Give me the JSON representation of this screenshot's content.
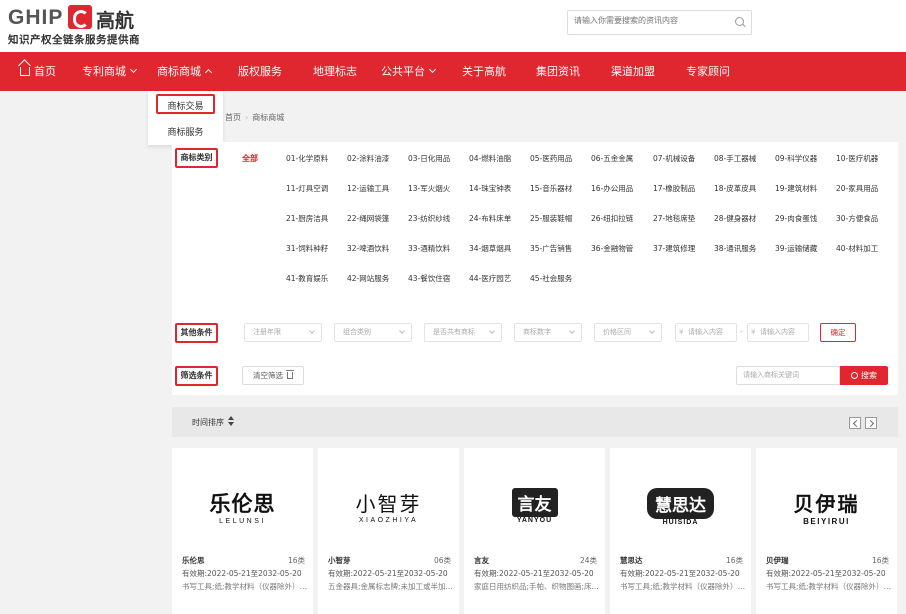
{
  "header": {
    "logo_text": "GHIP",
    "logo_cn": "高航",
    "slogan": "知识产权全链条服务提供商",
    "search_placeholder": "请输入你需要搜索的资讯内容"
  },
  "nav": {
    "items": [
      {
        "label": "首页",
        "has_home_icon": true
      },
      {
        "label": "专利商城",
        "has_dropdown": true
      },
      {
        "label": "商标商城",
        "has_dropdown": true,
        "expanded": true
      },
      {
        "label": "版权服务"
      },
      {
        "label": "地理标志"
      },
      {
        "label": "公共平台",
        "has_dropdown": true
      },
      {
        "label": "关于高航"
      },
      {
        "label": "集团资讯"
      },
      {
        "label": "渠道加盟"
      },
      {
        "label": "专家顾问"
      }
    ],
    "dropdown": [
      "商标交易",
      "商标服务"
    ]
  },
  "breadcrumb": {
    "parent": "首页",
    "current": "商标商城"
  },
  "filters": {
    "category_label": "商标类别",
    "all_label": "全部",
    "categories": [
      "01-化学原料",
      "02-涂料油漆",
      "03-日化用品",
      "04-燃料油脂",
      "05-医药用品",
      "06-五金金属",
      "07-机械设备",
      "08-手工器械",
      "09-科学仪器",
      "10-医疗机器",
      "11-灯具空调",
      "12-运输工具",
      "13-军火烟火",
      "14-珠宝钟表",
      "15-音乐器材",
      "16-办公用品",
      "17-橡胶制品",
      "18-皮革皮具",
      "19-建筑材料",
      "20-家具用品",
      "21-厨房洁具",
      "22-绳网袋篷",
      "23-纺织纱线",
      "24-布料床单",
      "25-服装鞋帽",
      "26-纽扣拉链",
      "27-地毯席垫",
      "28-健身器材",
      "29-肉食蛋饯",
      "30-方便食品",
      "31-饲料种籽",
      "32-啤酒饮料",
      "33-酒精饮料",
      "34-烟草烟具",
      "35-广告销售",
      "36-金融物管",
      "37-建筑修理",
      "38-通讯服务",
      "39-运输储藏",
      "40-材料加工",
      "41-教育娱乐",
      "42-网站服务",
      "43-餐饮住宿",
      "44-医疗园艺",
      "45-社会服务"
    ],
    "other_label": "其他条件",
    "selects": [
      "注册年限",
      "组合类别",
      "是否共有商标",
      "商标数字",
      "价格区间"
    ],
    "price_min_placeholder": "请输入内容",
    "price_max_placeholder": "请输入内容",
    "confirm_label": "确定",
    "screen_label": "筛选条件",
    "clear_label": "清空筛选",
    "keyword_placeholder": "请输入商标关键词",
    "search_label": "搜索"
  },
  "sort": {
    "label": "时间排序"
  },
  "cards": [
    {
      "logo": "乐伦思",
      "logo_sub": "LELUNSI",
      "name": "乐伦思",
      "class": "16类",
      "valid": "有效期:2022-05-21至2032-05-20",
      "desc": "书写工具;纸;教学材料（仪器除外）;..."
    },
    {
      "logo": "小智芽",
      "logo_sub": "XIAOZHIYA",
      "name": "小智芽",
      "class": "06类",
      "valid": "有效期:2022-05-21至2032-05-20",
      "desc": "五金器具;金属标志牌;未加工或半加..."
    },
    {
      "logo": "言友",
      "logo_sub": "YANYOU",
      "name": "言友",
      "class": "24类",
      "valid": "有效期:2022-05-21至2032-05-20",
      "desc": "家庭日用纺织品;手帕、织物图画;床..."
    },
    {
      "logo": "慧思达",
      "logo_sub": "HUISIDA",
      "name": "慧思达",
      "class": "16类",
      "valid": "有效期:2022-05-21至2032-05-20",
      "desc": "书写工具;纸;教学材料（仪器除外）;..."
    },
    {
      "logo": "贝伊瑞",
      "logo_sub": "BEIYIRUI",
      "name": "贝伊瑞",
      "class": "16类",
      "valid": "有效期:2022-05-21至2032-05-20",
      "desc": "书写工具;纸;教学材料（仪器除外）;..."
    }
  ],
  "colors": {
    "accent": "#e0262e",
    "background": "#f2f2f2"
  }
}
